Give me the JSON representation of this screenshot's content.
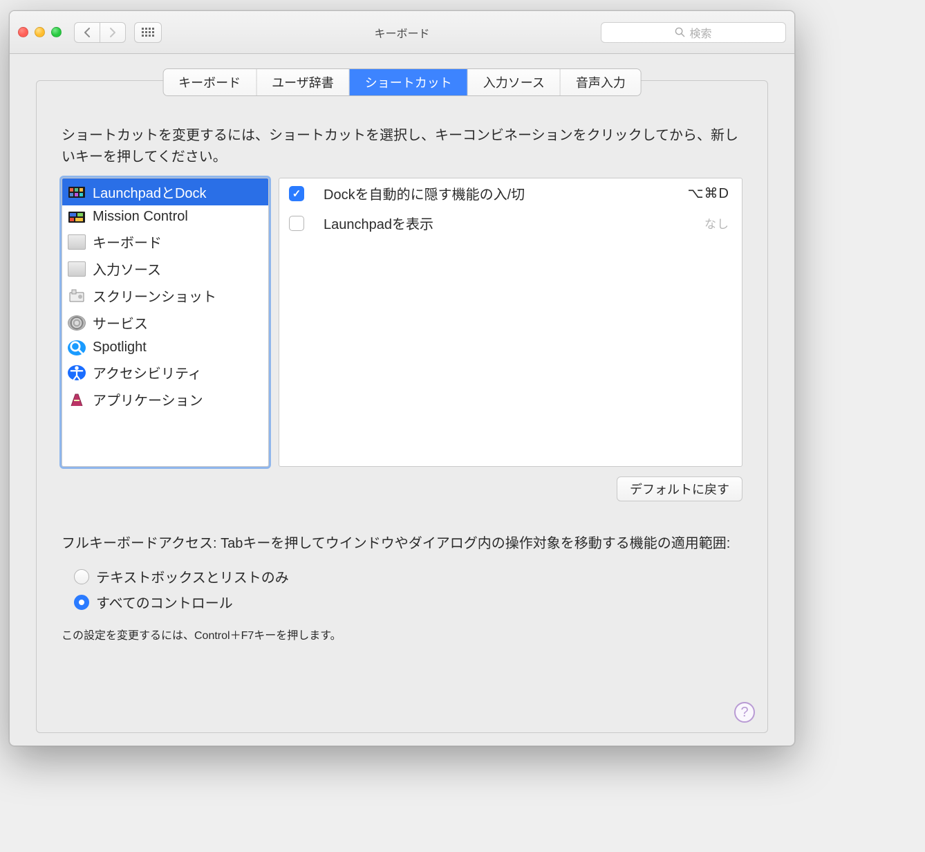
{
  "window": {
    "title": "キーボード"
  },
  "toolbar": {
    "back": "‹",
    "fwd": "›",
    "search_placeholder": "検索"
  },
  "tabs": [
    {
      "label": "キーボード",
      "active": false
    },
    {
      "label": "ユーザ辞書",
      "active": false
    },
    {
      "label": "ショートカット",
      "active": true
    },
    {
      "label": "入力ソース",
      "active": false
    },
    {
      "label": "音声入力",
      "active": false
    }
  ],
  "instructions": "ショートカットを変更するには、ショートカットを選択し、キーコンビネーションをクリックしてから、新しいキーを押してください。",
  "categories": [
    {
      "label": "LaunchpadとDock",
      "icon": "launchpad",
      "selected": true
    },
    {
      "label": "Mission Control",
      "icon": "mission",
      "selected": false
    },
    {
      "label": "キーボード",
      "icon": "keyboard",
      "selected": false
    },
    {
      "label": "入力ソース",
      "icon": "keyboard",
      "selected": false
    },
    {
      "label": "スクリーンショット",
      "icon": "screenshot",
      "selected": false
    },
    {
      "label": "サービス",
      "icon": "services",
      "selected": false
    },
    {
      "label": "Spotlight",
      "icon": "spotlight",
      "selected": false
    },
    {
      "label": "アクセシビリティ",
      "icon": "accessibility",
      "selected": false
    },
    {
      "label": "アプリケーション",
      "icon": "applications",
      "selected": false
    }
  ],
  "shortcuts": [
    {
      "label": "Dockを自動的に隠す機能の入/切",
      "enabled": true,
      "keys": "⌥⌘D"
    },
    {
      "label": "Launchpadを表示",
      "enabled": false,
      "keys": "なし",
      "none": true
    }
  ],
  "buttons": {
    "restore_defaults": "デフォルトに戻す"
  },
  "keyboard_access": {
    "text": "フルキーボードアクセス: Tabキーを押してウインドウやダイアログ内の操作対象を移動する機能の適用範囲:",
    "options": [
      {
        "label": "テキストボックスとリストのみ",
        "selected": false
      },
      {
        "label": "すべてのコントロール",
        "selected": true
      }
    ],
    "hint": "この設定を変更するには、Control＋F7キーを押します。"
  },
  "help_label": "?"
}
